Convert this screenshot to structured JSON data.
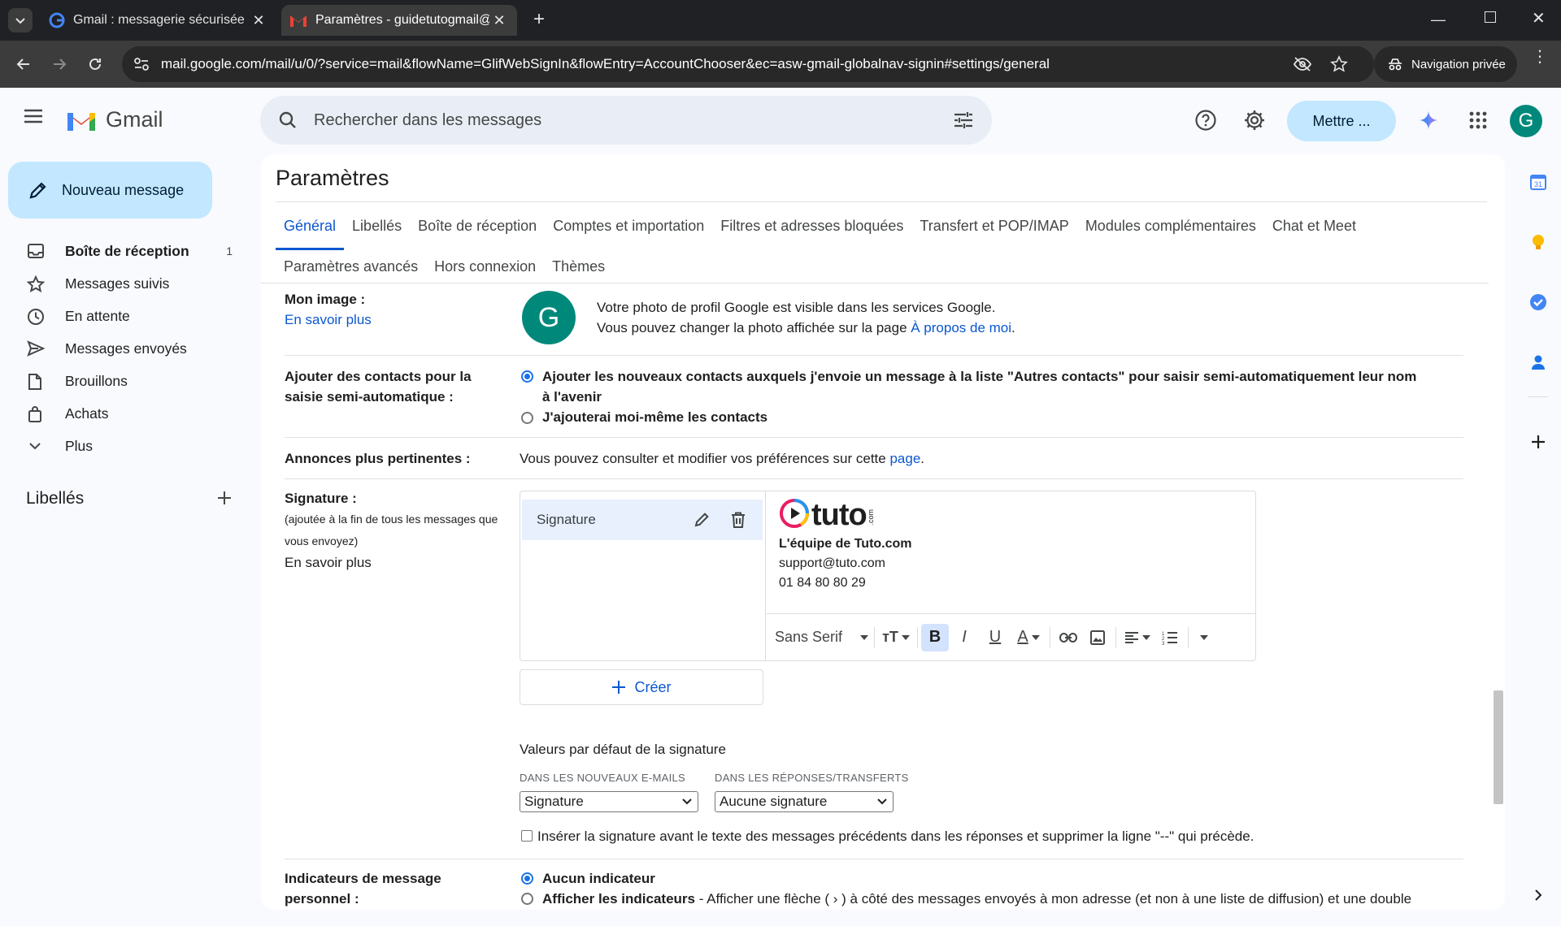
{
  "browser": {
    "tabs": [
      {
        "title": "Gmail : messagerie sécurisée op",
        "active": false
      },
      {
        "title": "Paramètres - guidetutogmail@",
        "active": true
      }
    ],
    "url": "mail.google.com/mail/u/0/?service=mail&flowName=GlifWebSignIn&flowEntry=AccountChooser&ec=asw-gmail-globalnav-signin#settings/general",
    "private_label": "Navigation privée"
  },
  "header": {
    "app_name": "Gmail",
    "search_placeholder": "Rechercher dans les messages",
    "upgrade_label": "Mettre ...",
    "avatar_letter": "G"
  },
  "sidebar": {
    "compose_label": "Nouveau message",
    "items": [
      {
        "label": "Boîte de réception",
        "count": "1",
        "icon": "inbox-icon",
        "bold": true
      },
      {
        "label": "Messages suivis",
        "count": "",
        "icon": "star-icon"
      },
      {
        "label": "En attente",
        "count": "",
        "icon": "clock-icon"
      },
      {
        "label": "Messages envoyés",
        "count": "",
        "icon": "send-icon"
      },
      {
        "label": "Brouillons",
        "count": "",
        "icon": "draft-icon"
      },
      {
        "label": "Achats",
        "count": "",
        "icon": "shopping-bag-icon"
      },
      {
        "label": "Plus",
        "count": "",
        "icon": "chevron-down-icon"
      }
    ],
    "labels_header": "Libellés"
  },
  "settings": {
    "title": "Paramètres",
    "tabs_row1": [
      "Général",
      "Libellés",
      "Boîte de réception",
      "Comptes et importation",
      "Filtres et adresses bloquées",
      "Transfert et POP/IMAP",
      "Modules complémentaires",
      "Chat et Meet"
    ],
    "tabs_row2": [
      "Paramètres avancés",
      "Hors connexion",
      "Thèmes"
    ],
    "active_tab": "Général",
    "my_picture": {
      "label": "Mon image :",
      "learn_more": "En savoir plus",
      "avatar_letter": "G",
      "line1": "Votre photo de profil Google est visible dans les services Google.",
      "line2_prefix": "Vous pouvez changer la photo affichée sur la page ",
      "line2_link": "À propos de moi",
      "line2_suffix": "."
    },
    "autocomplete": {
      "label_line1": "Ajouter des contacts pour la",
      "label_line2": "saisie semi-automatique :",
      "option1_line1": "Ajouter les nouveaux contacts auxquels j'envoie un message à la liste \"Autres contacts\" pour saisir semi-automatiquement leur nom",
      "option1_line2": "à l'avenir",
      "option2": "J'ajouterai moi-même les contacts",
      "selected": 1
    },
    "ads": {
      "label": "Annonces plus pertinentes :",
      "text": "Vous pouvez consulter et modifier vos préférences sur cette ",
      "link": "page",
      "suffix": "."
    },
    "signature": {
      "label": "Signature :",
      "note_line1": "(ajoutée à la fin de tous les messages que",
      "note_line2": "vous envoyez)",
      "learn_more": "En savoir plus",
      "list_item": "Signature",
      "logo_text": "tuto",
      "logo_small": ".com",
      "line1": "L'équipe de Tuto.com",
      "line2": "support@tuto.com",
      "line3": "01 84 80 80 29",
      "font_select": "Sans Serif",
      "create_label": "Créer",
      "defaults_title": "Valeurs par défaut de la signature",
      "new_mail_caption": "DANS LES NOUVEAUX E-MAILS",
      "reply_caption": "DANS LES RÉPONSES/TRANSFERTS",
      "new_mail_value": "Signature",
      "reply_value": "Aucune signature",
      "insert_before": "Insérer la signature avant le texte des messages précédents dans les réponses et supprimer la ligne \"--\" qui précède."
    },
    "indicators": {
      "label_line1": "Indicateurs de message",
      "label_line2": "personnel :",
      "option1": "Aucun indicateur",
      "option2_bold": "Afficher les indicateurs",
      "option2_text": " - Afficher une flèche ( › ) à côté des messages envoyés à mon adresse (et non à une liste de diffusion) et une double"
    }
  },
  "colors": {
    "accent": "#0b57d0",
    "compose_bg": "#c2e7ff",
    "avatar": "#00897b"
  }
}
